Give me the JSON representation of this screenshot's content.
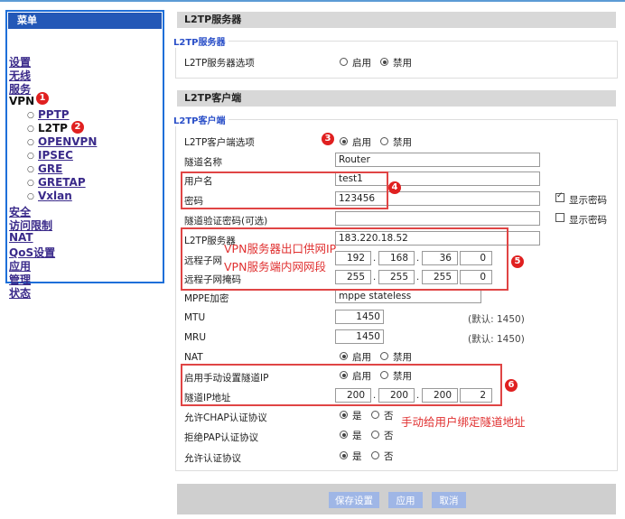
{
  "sidebar": {
    "title": "菜单",
    "items": [
      {
        "label": "设置"
      },
      {
        "label": "无线"
      },
      {
        "label": "服务"
      },
      {
        "label": "VPN"
      },
      {
        "label": "PPTP"
      },
      {
        "label": "L2TP"
      },
      {
        "label": "OPENVPN"
      },
      {
        "label": "IPSEC"
      },
      {
        "label": "GRE"
      },
      {
        "label": "GRETAP"
      },
      {
        "label": "Vxlan"
      },
      {
        "label": "安全"
      },
      {
        "label": "访问限制"
      },
      {
        "label": "NAT"
      },
      {
        "label": "QoS设置"
      },
      {
        "label": "应用"
      },
      {
        "label": "管理"
      },
      {
        "label": "状态"
      }
    ]
  },
  "server": {
    "section_title": "L2TP服务器",
    "legend": "L2TP服务器",
    "option_label": "L2TP服务器选项",
    "enable": "启用",
    "disable": "禁用",
    "selected": "disable"
  },
  "client": {
    "section_title": "L2TP客户端",
    "legend": "L2TP客户端",
    "option_label": "L2TP客户端选项",
    "enable": "启用",
    "disable": "禁用",
    "selected": "enable",
    "tunnel_name_label": "隧道名称",
    "tunnel_name": "Router",
    "username_label": "用户名",
    "username": "test1",
    "password_label": "密码",
    "password": "123456",
    "show_password": "显示密码",
    "show_password_checked": true,
    "auth_password_label": "隧道验证密码(可选)",
    "auth_password": "",
    "show_auth_password": "显示密码",
    "show_auth_password_checked": false,
    "server_label": "L2TP服务器",
    "server": "183.220.18.52",
    "remote_subnet_label": "远程子网",
    "remote_subnet": [
      "192",
      "168",
      "36",
      "0"
    ],
    "remote_mask_label": "远程子网掩码",
    "remote_mask": [
      "255",
      "255",
      "255",
      "0"
    ],
    "mppe_label": "MPPE加密",
    "mppe": "mppe stateless",
    "mtu_label": "MTU",
    "mtu": "1450",
    "mtu_default": "(默认: 1450)",
    "mru_label": "MRU",
    "mru": "1450",
    "mru_default": "(默认: 1450)",
    "nat_label": "NAT",
    "nat_enable": "启用",
    "nat_disable": "禁用",
    "nat_selected": "enable",
    "manual_ip_label": "启用手动设置隧道IP",
    "manual_enable": "启用",
    "manual_disable": "禁用",
    "manual_selected": "enable",
    "tunnel_ip_label": "隧道IP地址",
    "tunnel_ip": [
      "200",
      "200",
      "200",
      "2"
    ],
    "chap_label": "允许CHAP认证协议",
    "pap_label": "拒绝PAP认证协议",
    "auth_label": "允许认证协议",
    "yes": "是",
    "no": "否"
  },
  "annotations": {
    "badges": [
      "1",
      "2",
      "3",
      "4",
      "5",
      "6"
    ],
    "note_server": "VPN服务器出口供网IP",
    "note_subnet": "VPN服务端内网网段",
    "note_tunnel": "手动给用户绑定隧道地址",
    "box_color": "#e04545"
  },
  "buttons": {
    "save": "保存设置",
    "apply": "应用",
    "cancel": "取消"
  }
}
